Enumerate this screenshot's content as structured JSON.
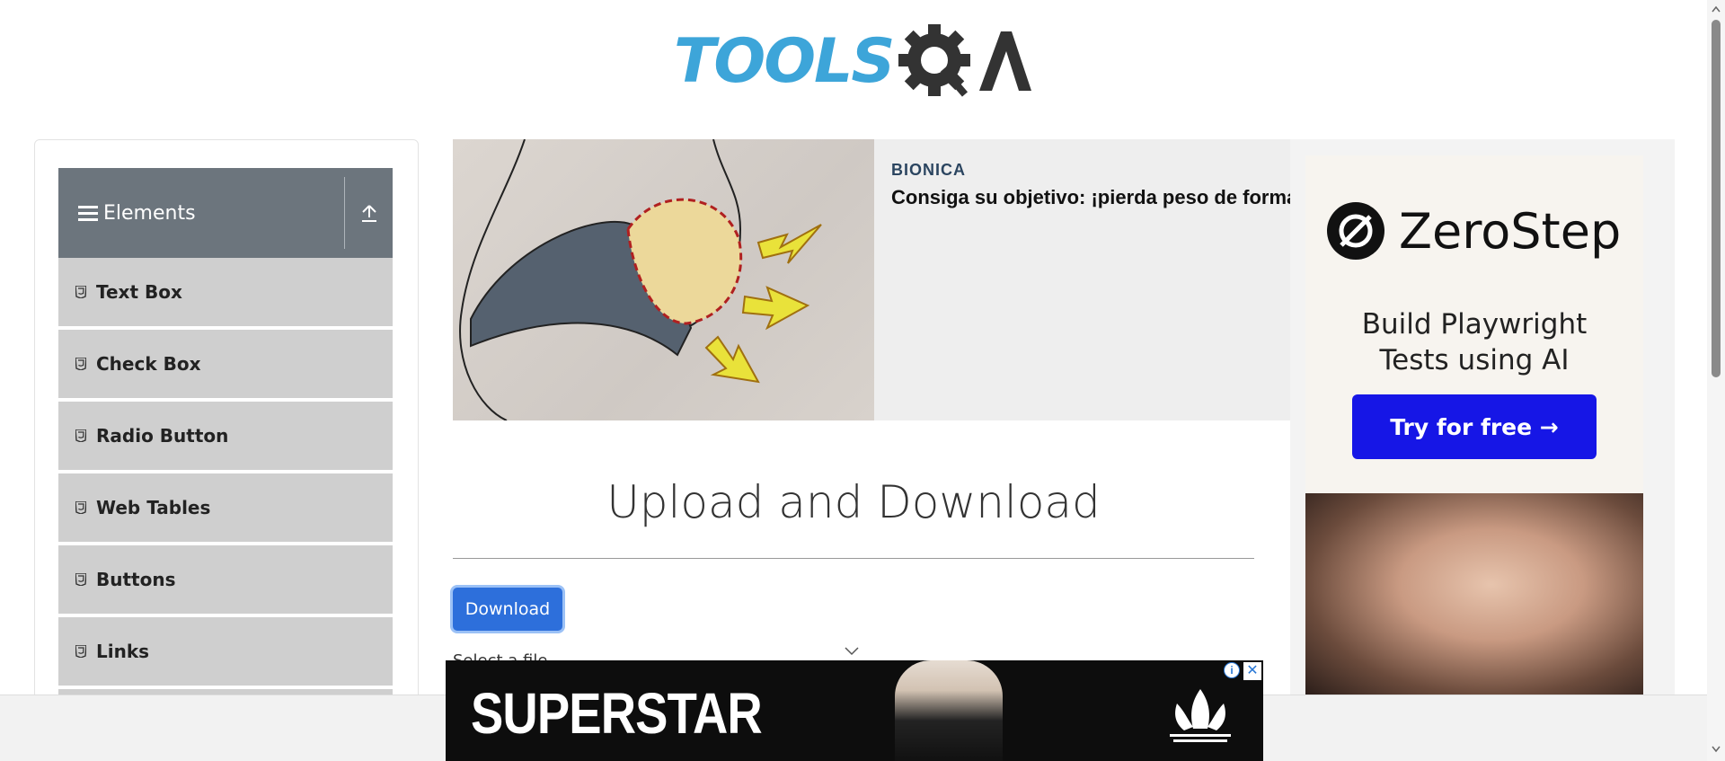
{
  "header": {
    "logo_text": "TOOLS",
    "logo_suffix": "QA"
  },
  "sidebar": {
    "group_title": "Elements",
    "items": [
      {
        "label": "Text Box"
      },
      {
        "label": "Check Box"
      },
      {
        "label": "Radio Button"
      },
      {
        "label": "Web Tables"
      },
      {
        "label": "Buttons"
      },
      {
        "label": "Links"
      }
    ]
  },
  "ads": {
    "top": {
      "brand": "BIONICA",
      "headline": "Consiga su objetivo: ¡pierda peso de forma"
    },
    "right": {
      "brand": "ZeroStep",
      "tagline_line1": "Build Playwright",
      "tagline_line2": "Tests using AI",
      "cta": "Try for free →"
    },
    "bottom": {
      "word": "SUPERSTAR",
      "info": "i",
      "close": "✕"
    }
  },
  "main": {
    "title": "Upload and Download",
    "download_label": "Download",
    "select_label": "Select a file"
  },
  "colors": {
    "sidebar_header": "#6c757d",
    "sidebar_item": "#cfcfcf",
    "primary": "#2d6fdb",
    "logo_blue": "#3da5d9",
    "zerostep_cta": "#1616e6"
  }
}
